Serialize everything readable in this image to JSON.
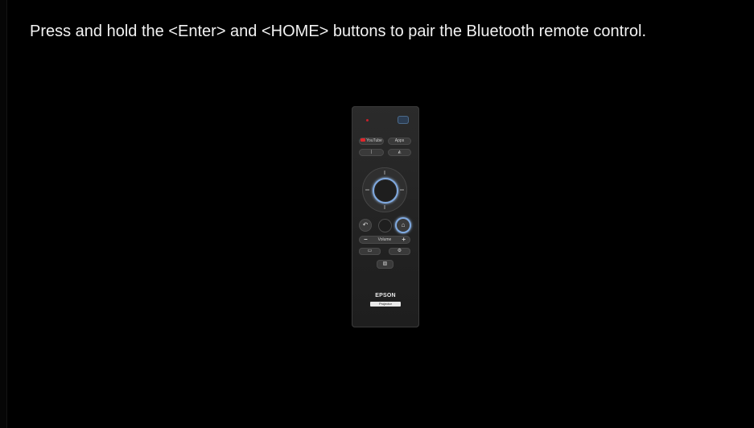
{
  "instruction": {
    "text": "Press and hold the <Enter> and <HOME> buttons to pair the Bluetooth remote control."
  },
  "remote": {
    "youtube_label": "YouTube",
    "apps_label": "Apps",
    "mic_label": "❘",
    "input_label": "◭",
    "back_label": "↶",
    "home_label": "⌂",
    "volume_minus": "−",
    "volume_label": "Volume",
    "volume_plus": "+",
    "aspect_label": "▭",
    "settings_label": "⚙",
    "freeze_label": "▨",
    "brand": "EPSON",
    "brand_tag": "Projector",
    "highlight_color": "#7fa9e0",
    "led_color": "#c8202a",
    "youtube_color": "#e0262b",
    "icons": {
      "back": "back-arrow-icon",
      "home": "home-icon",
      "mic": "microphone-icon",
      "input": "input-source-icon",
      "aspect": "aspect-ratio-icon",
      "settings": "settings-icon",
      "freeze": "freeze-icon"
    }
  }
}
